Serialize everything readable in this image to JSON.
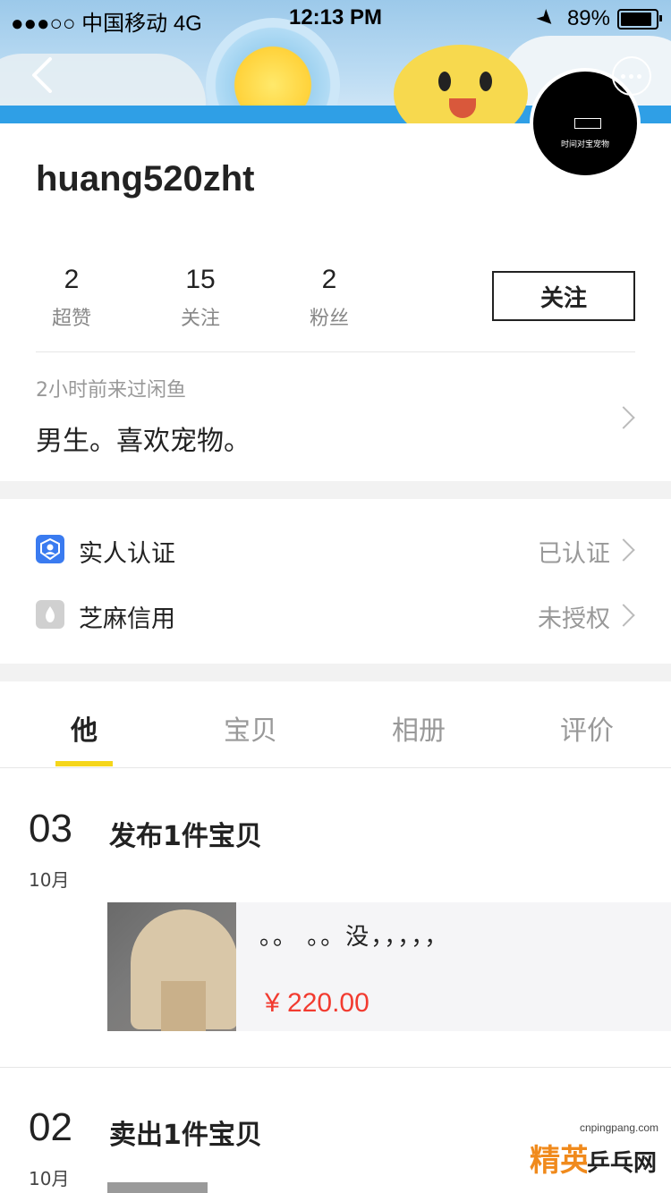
{
  "status_bar": {
    "carrier": "●●●○○ 中国移动   4G",
    "time": "12:13 PM",
    "battery": "89%"
  },
  "header": {
    "avatar_caption": "时间对宝宠物"
  },
  "profile": {
    "username": "huang520zht",
    "stats": [
      {
        "value": "2",
        "label": "超赞"
      },
      {
        "value": "15",
        "label": "关注"
      },
      {
        "value": "2",
        "label": "粉丝"
      }
    ],
    "follow_label": "关注",
    "last_visit": "2小时前来过闲鱼",
    "bio": "男生。喜欢宠物。"
  },
  "verification": [
    {
      "icon": "person-verified-icon",
      "label": "实人认证",
      "value": "已认证",
      "color": "#3a7bf0"
    },
    {
      "icon": "sesame-credit-icon",
      "label": "芝麻信用",
      "value": "未授权",
      "color": "#c8c8c8"
    }
  ],
  "tabs": [
    {
      "label": "他",
      "active": true
    },
    {
      "label": "宝贝",
      "active": false
    },
    {
      "label": "相册",
      "active": false
    },
    {
      "label": "评价",
      "active": false
    }
  ],
  "feed": [
    {
      "day": "03",
      "month": "10月",
      "title": "发布1件宝贝",
      "item": {
        "description": "。。 。。没，，，，，",
        "price": "¥ 220.00"
      }
    },
    {
      "day": "02",
      "month": "10月",
      "title": "卖出1件宝贝"
    }
  ],
  "watermark": {
    "site": "cnpingpang.com",
    "brand_left": "精英",
    "brand_right": "乒乓网"
  },
  "colors": {
    "accent_yellow": "#f5d61b",
    "price_red": "#f23b30"
  }
}
